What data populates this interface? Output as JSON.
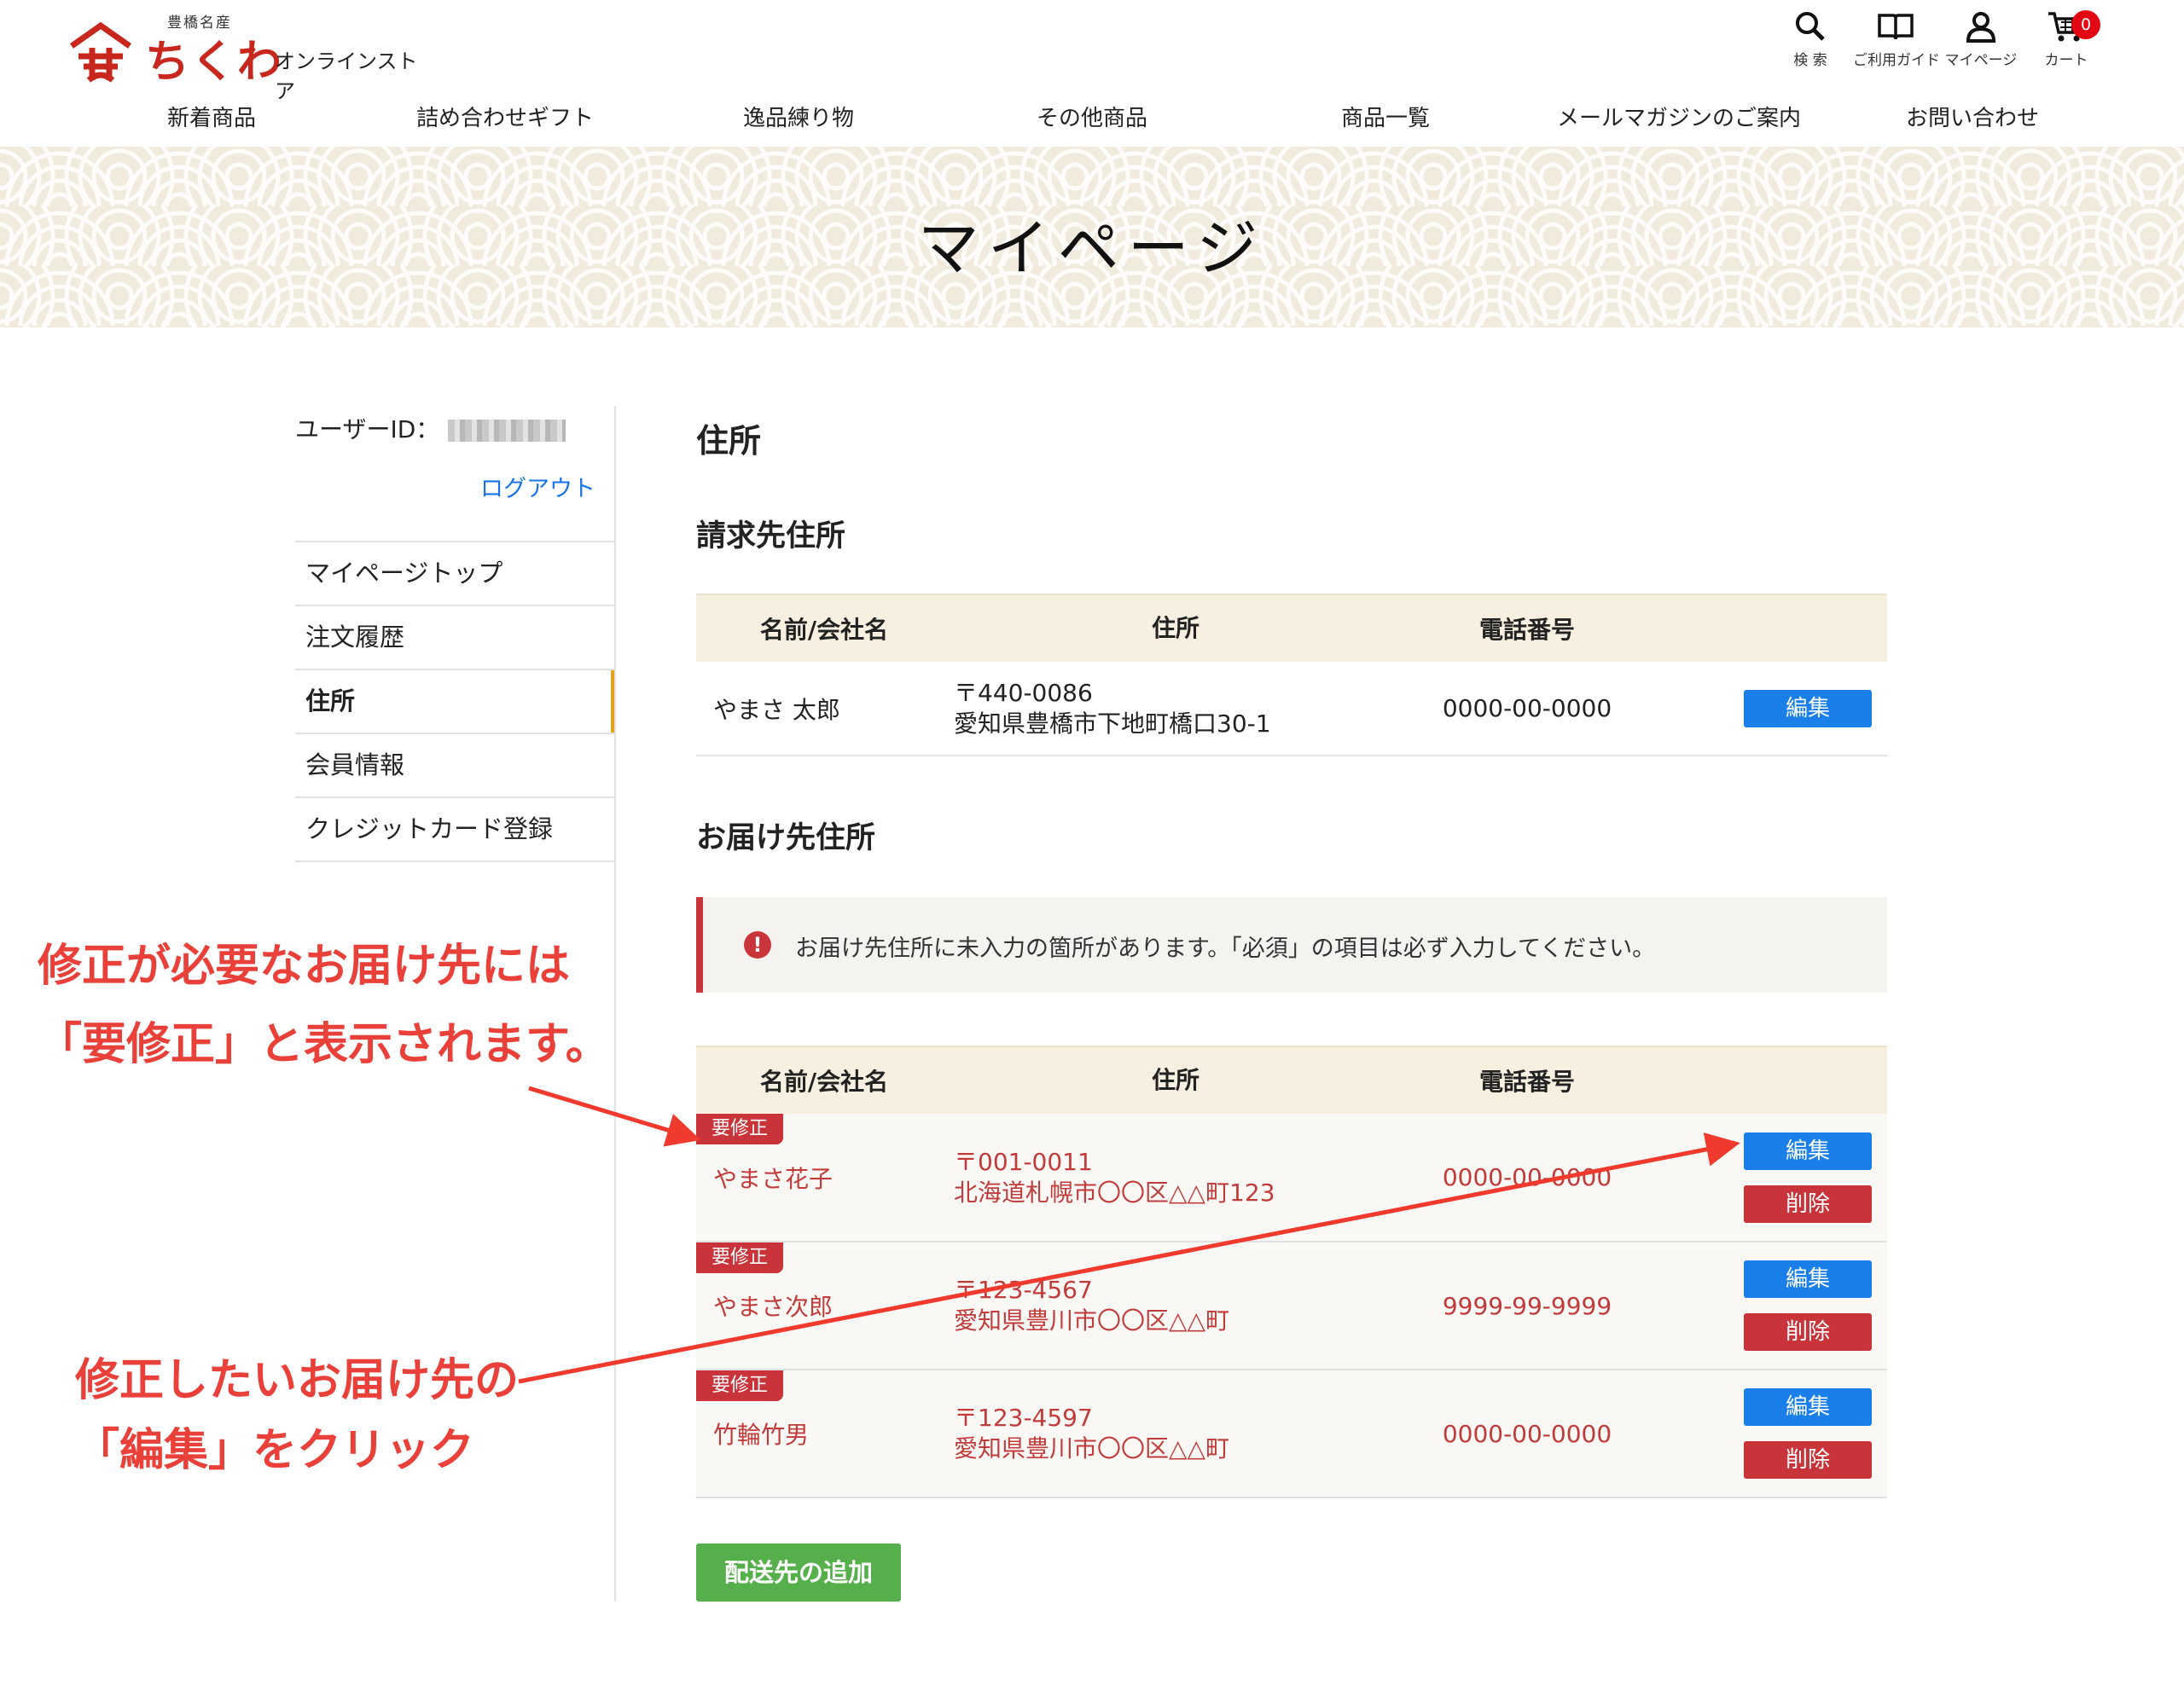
{
  "brand": {
    "tagline": "豊橋名産",
    "name": "ちくわ",
    "subtitle": "オンラインストア",
    "color": "#c8271d"
  },
  "utility": [
    {
      "label": "検 索",
      "icon": "search-icon"
    },
    {
      "label": "ご利用ガイド",
      "icon": "book-icon"
    },
    {
      "label": "マイページ",
      "icon": "user-icon"
    },
    {
      "label": "カート",
      "icon": "cart-icon",
      "badge": "0"
    }
  ],
  "nav": [
    "新着商品",
    "詰め合わせギフト",
    "逸品練り物",
    "その他商品",
    "商品一覧",
    "メールマガジンのご案内",
    "お問い合わせ"
  ],
  "hero": {
    "title": "マイページ"
  },
  "sidebar": {
    "user_id_label": "ユーザーID：",
    "logout": "ログアウト",
    "menu": [
      {
        "label": "マイページトップ",
        "active": false
      },
      {
        "label": "注文履歴",
        "active": false
      },
      {
        "label": "住所",
        "active": true
      },
      {
        "label": "会員情報",
        "active": false
      },
      {
        "label": "クレジットカード登録",
        "active": false
      }
    ]
  },
  "main": {
    "title": "住所",
    "billing": {
      "heading": "請求先住所",
      "columns": [
        "名前/会社名",
        "住所",
        "電話番号"
      ],
      "row": {
        "name": "やまさ 太郎",
        "postal": "〒440-0086",
        "address": "愛知県豊橋市下地町橋口30-1",
        "tel": "0000-00-0000",
        "edit": "編集"
      }
    },
    "delivery": {
      "heading": "お届け先住所",
      "alert": "お届け先住所に未入力の箇所があります。「必須」の項目は必ず入力してください。",
      "alert_icon": "!",
      "columns": [
        "名前/会社名",
        "住所",
        "電話番号"
      ],
      "rows": [
        {
          "tag": "要修正",
          "name": "やまさ花子",
          "postal": "〒001-0011",
          "address": "北海道札幌市〇〇区△△町123",
          "tel": "0000-00-0000",
          "edit": "編集",
          "delete": "削除"
        },
        {
          "tag": "要修正",
          "name": "やまさ次郎",
          "postal": "〒123-4567",
          "address": "愛知県豊川市〇〇区△△町",
          "tel": "9999-99-9999",
          "edit": "編集",
          "delete": "削除"
        },
        {
          "tag": "要修正",
          "name": "竹輪竹男",
          "postal": "〒123-4597",
          "address": "愛知県豊川市〇〇区△△町",
          "tel": "0000-00-0000",
          "edit": "編集",
          "delete": "削除"
        }
      ],
      "add_button": "配送先の追加"
    }
  },
  "annotations": {
    "top_line1": "修正が必要なお届け先には",
    "top_line2": "「要修正」と表示されます。",
    "bottom_line1": "修正したいお届け先の",
    "bottom_line2": "「編集」をクリック",
    "color": "#e9413a"
  },
  "colors": {
    "edit_button": "#1a7fe8",
    "delete_button": "#c9343a",
    "add_button": "#55b04b",
    "warn_text": "#c23b3b",
    "table_header": "#f7efe0",
    "hero_bg": "#f1ebdd",
    "active_marker": "#e2a41a"
  }
}
